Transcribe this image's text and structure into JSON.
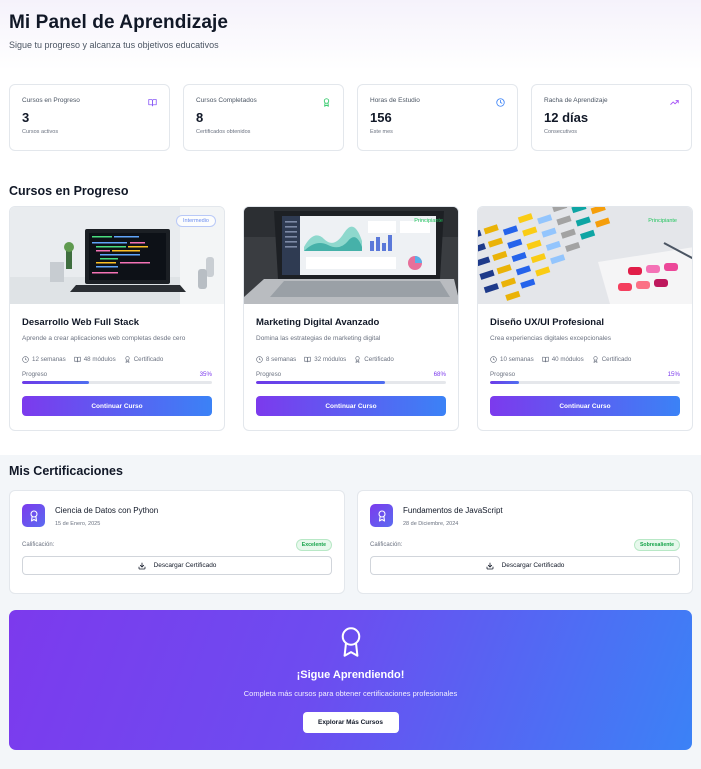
{
  "header": {
    "title": "Mi Panel de Aprendizaje",
    "subtitle": "Sigue tu progreso y alcanza tus objetivos educativos"
  },
  "stats": [
    {
      "label": "Cursos en Progreso",
      "value": "3",
      "sub": "Cursos activos",
      "icon": "book-open-icon",
      "color": "#8b5cf6"
    },
    {
      "label": "Cursos Completados",
      "value": "8",
      "sub": "Certificados obtenidos",
      "icon": "award-icon",
      "color": "#22c55e"
    },
    {
      "label": "Horas de Estudio",
      "value": "156",
      "sub": "Este mes",
      "icon": "clock-icon",
      "color": "#3b82f6"
    },
    {
      "label": "Racha de Aprendizaje",
      "value": "12 días",
      "sub": "Consecutivos",
      "icon": "trending-up-icon",
      "color": "#a855f7"
    }
  ],
  "courses_section": {
    "title": "Cursos en Progreso"
  },
  "courses": [
    {
      "level": "Intermedio",
      "level_color": "#6b8df0",
      "title": "Desarrollo Web Full Stack",
      "desc": "Aprende a crear aplicaciones web completas desde cero",
      "weeks": "12 semanas",
      "modules": "48 módulos",
      "cert": "Certificado",
      "progress_label": "Progreso",
      "progress_text": "35%",
      "progress": 0.35,
      "button": "Continuar Curso"
    },
    {
      "level": "Principiante",
      "level_color": "#22c55e",
      "title": "Marketing Digital Avanzado",
      "desc": "Domina las estrategias de marketing digital",
      "weeks": "8 semanas",
      "modules": "32 módulos",
      "cert": "Certificado",
      "progress_label": "Progreso",
      "progress_text": "68%",
      "progress": 0.68,
      "button": "Continuar Curso"
    },
    {
      "level": "Principiante",
      "level_color": "#22c55e",
      "title": "Diseño UX/UI Profesional",
      "desc": "Crea experiencias digitales excepcionales",
      "weeks": "10 semanas",
      "modules": "40 módulos",
      "cert": "Certificado",
      "progress_label": "Progreso",
      "progress_text": "15%",
      "progress": 0.15,
      "button": "Continuar Curso"
    }
  ],
  "certs_section": {
    "title": "Mis Certificaciones"
  },
  "certs": [
    {
      "name": "Ciencia de Datos con Python",
      "date": "15 de Enero, 2025",
      "grade_label": "Calificación:",
      "grade": "Excelente",
      "button": "Descargar Certificado"
    },
    {
      "name": "Fundamentos de JavaScript",
      "date": "28 de Diciembre, 2024",
      "grade_label": "Calificación:",
      "grade": "Sobresaliente",
      "button": "Descargar Certificado"
    }
  ],
  "cta": {
    "title": "¡Sigue Aprendiendo!",
    "text": "Completa más cursos para obtener certificaciones profesionales",
    "button": "Explorar Más Cursos"
  },
  "colors": {
    "accent_purple": "#7c3aed",
    "accent_blue": "#3b82f6",
    "success": "#16a34a"
  }
}
